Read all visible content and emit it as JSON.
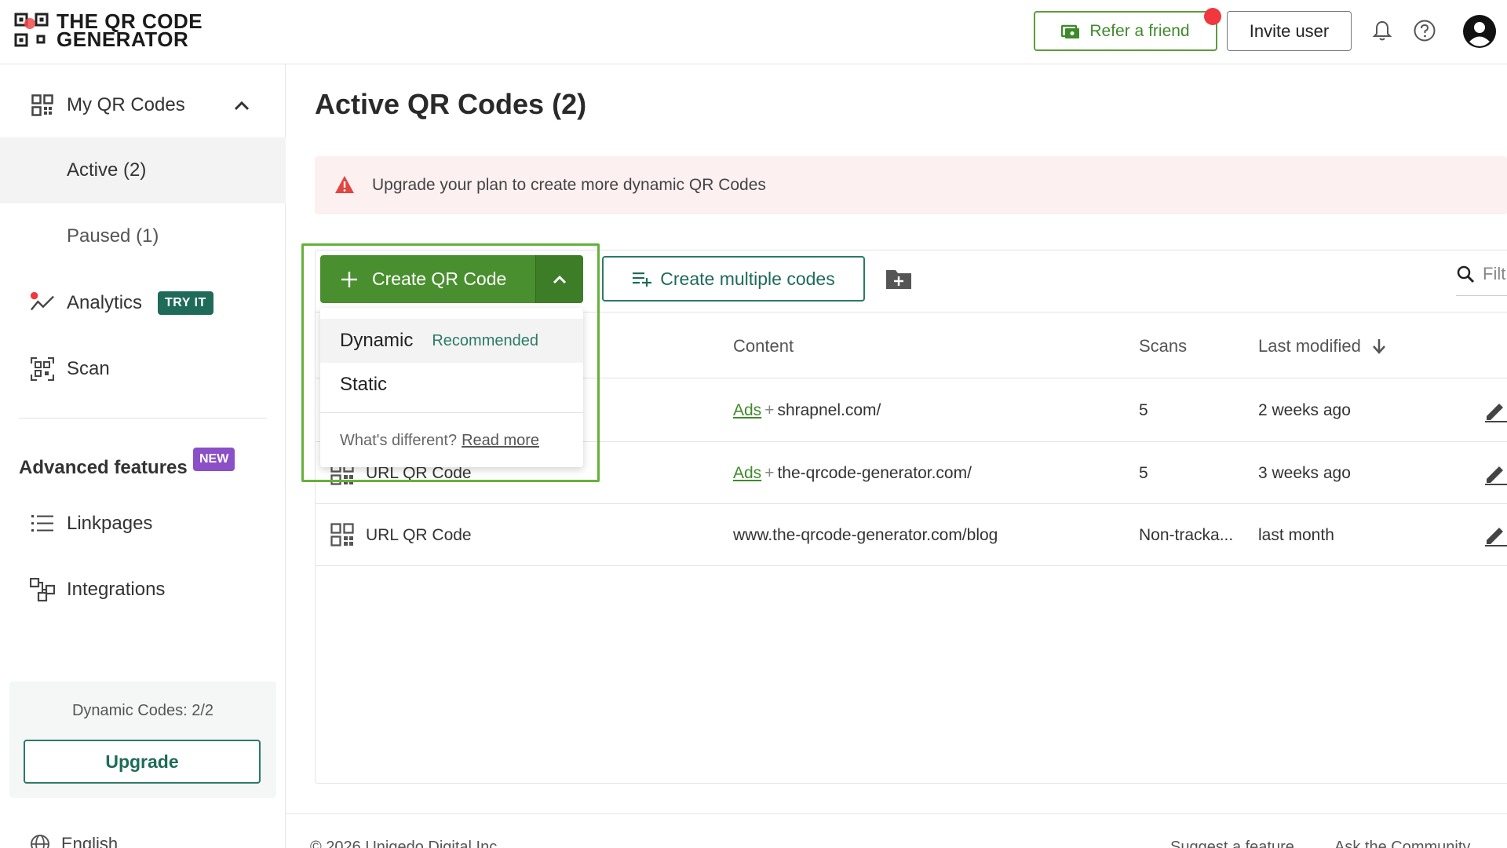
{
  "header": {
    "logo_line1": "THE QR CODE",
    "logo_line2": "GENERATOR",
    "refer_label": "Refer a friend",
    "invite_label": "Invite user"
  },
  "sidebar": {
    "my_qr_codes": "My QR Codes",
    "active": "Active (2)",
    "paused": "Paused (1)",
    "analytics": "Analytics",
    "analytics_badge": "TRY IT",
    "scan": "Scan",
    "advanced_features": "Advanced features",
    "advanced_badge": "NEW",
    "linkpages": "Linkpages",
    "integrations": "Integrations",
    "dynamic_codes": "Dynamic Codes: 2/2",
    "upgrade": "Upgrade",
    "language": "English"
  },
  "main": {
    "title": "Active QR Codes (2)",
    "alert": "Upgrade your plan to create more dynamic QR Codes",
    "create_label": "Create QR Code",
    "multi_label": "Create multiple codes",
    "search_placeholder": "Filt",
    "columns": {
      "content": "Content",
      "scans": "Scans",
      "last_modified": "Last modified"
    },
    "rows": [
      {
        "name": "",
        "content_link": "Ads",
        "content_sep": "+",
        "content_url": "shrapnel.com/",
        "scans": "5",
        "modified": "2 weeks ago"
      },
      {
        "name": "URL QR Code",
        "content_link": "Ads",
        "content_sep": "+",
        "content_url": "the-qrcode-generator.com/",
        "scans": "5",
        "modified": "3 weeks ago"
      },
      {
        "name": "URL QR Code",
        "content_link": "",
        "content_sep": "",
        "content_url": "www.the-qrcode-generator.com/blog",
        "scans": "Non-tracka...",
        "modified": "last month"
      }
    ]
  },
  "dropdown": {
    "dynamic": "Dynamic",
    "recommended": "Recommended",
    "static": "Static",
    "whats_different": "What's different?",
    "read_more": "Read more"
  },
  "footer": {
    "copyright": "© 2026 Unigedo Digital Inc",
    "suggest": "Suggest a feature",
    "community": "Ask the Community"
  },
  "colors": {
    "primary_green": "#4a8f2f",
    "teal": "#1e6b5a",
    "alert_bg": "#fdf0f0",
    "alert_icon": "#e0463f",
    "purple_badge": "#8b4fc7"
  }
}
